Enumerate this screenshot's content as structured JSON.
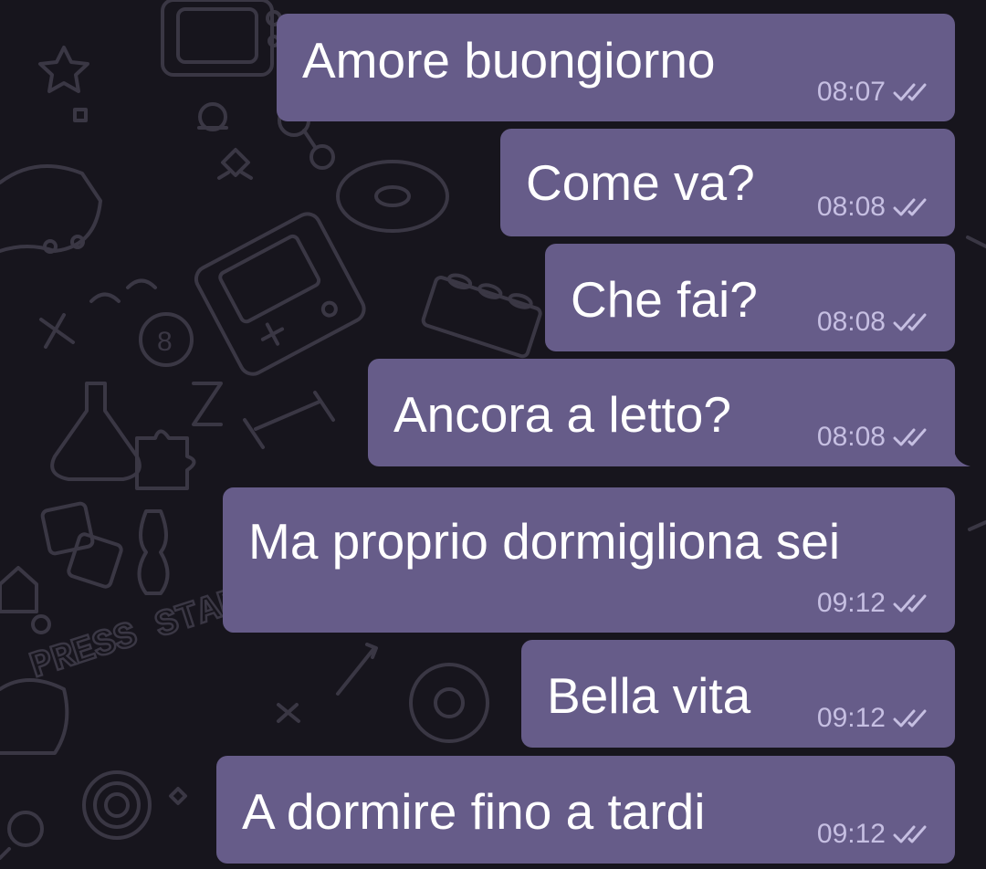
{
  "theme": {
    "background": "#17151d",
    "bubble": "#665c89",
    "bubble_text": "#ffffff",
    "meta_text": "#c6bfe2",
    "doodle": "#3a3744"
  },
  "messages": [
    {
      "text": "Amore buongiorno",
      "time": "08:07",
      "status": "read-double-check-icon"
    },
    {
      "text": "Come va?",
      "time": "08:08",
      "status": "read-double-check-icon"
    },
    {
      "text": "Che fai?",
      "time": "08:08",
      "status": "read-double-check-icon"
    },
    {
      "text": "Ancora a letto?",
      "time": "08:08",
      "status": "read-double-check-icon"
    },
    {
      "text": "Ma proprio dormigliona sei",
      "time": "09:12",
      "status": "read-double-check-icon"
    },
    {
      "text": "Bella vita",
      "time": "09:12",
      "status": "read-double-check-icon"
    },
    {
      "text": "A dormire fino a tardi",
      "time": "09:12",
      "status": "read-double-check-icon"
    }
  ],
  "wallpaper": {
    "doodle_text": "PRESS START"
  }
}
